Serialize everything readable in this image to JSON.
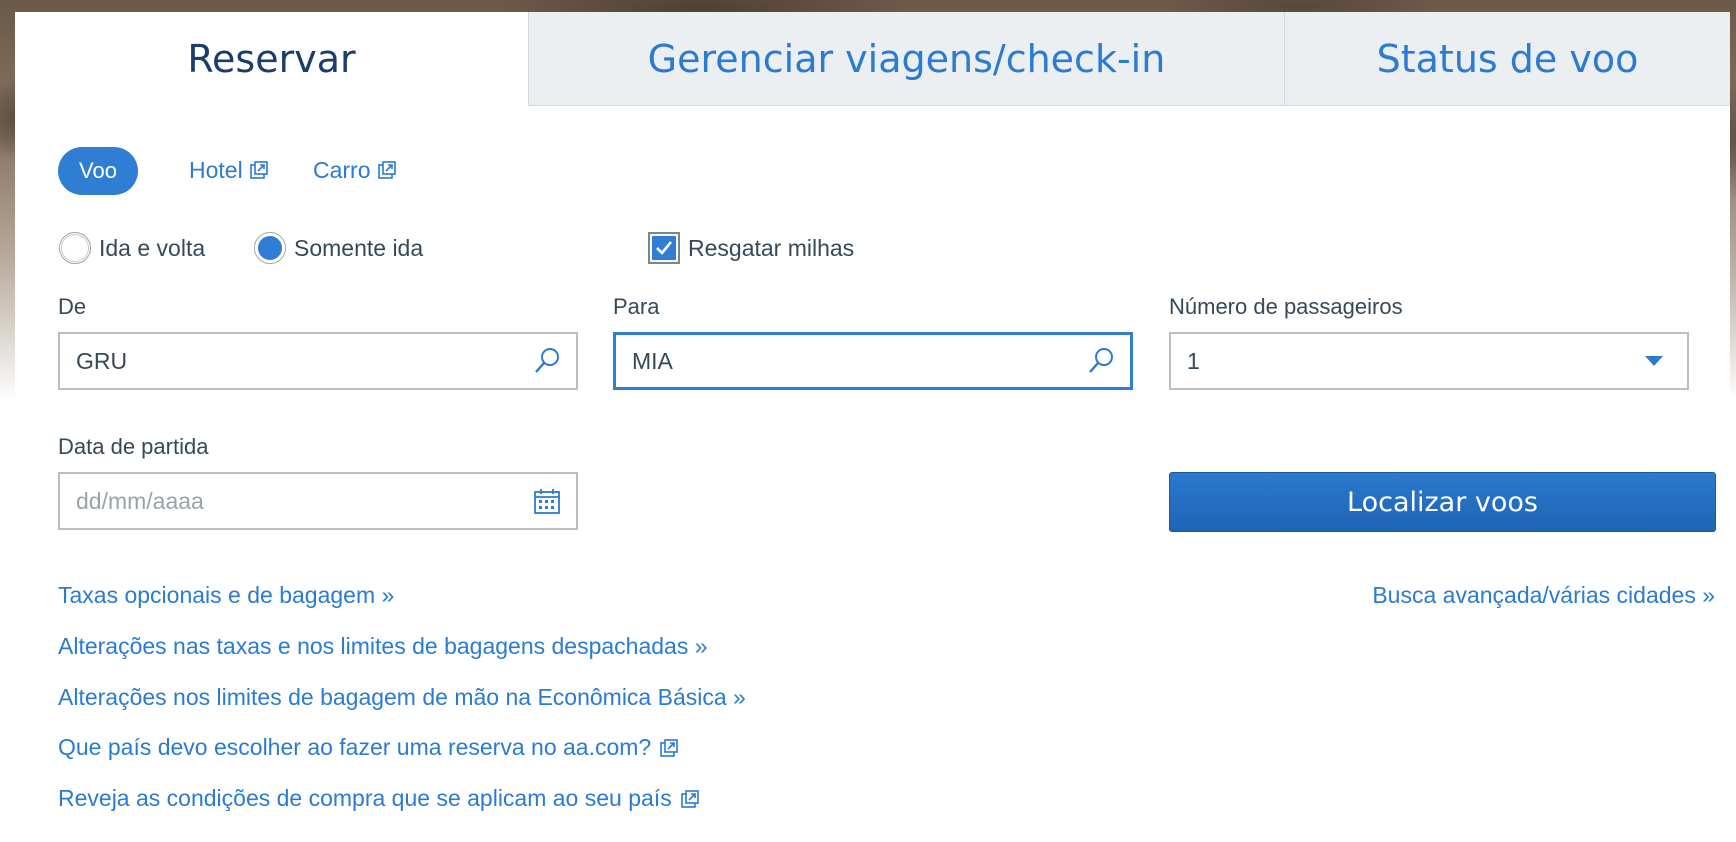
{
  "tabs": [
    {
      "label": "Reservar"
    },
    {
      "label": "Gerenciar viagens/check-in"
    },
    {
      "label": "Status de voo"
    }
  ],
  "products": {
    "flight": "Voo",
    "hotel": "Hotel",
    "car": "Carro"
  },
  "trip_type": {
    "round_trip": "Ida e volta",
    "one_way": "Somente ida",
    "selected": "one_way"
  },
  "redeem_miles": {
    "label": "Resgatar milhas",
    "checked": true
  },
  "from": {
    "label": "De",
    "value": "GRU"
  },
  "to": {
    "label": "Para",
    "value": "MIA"
  },
  "passengers": {
    "label": "Número de passageiros",
    "value": "1"
  },
  "departure": {
    "label": "Data de partida",
    "placeholder": "dd/mm/aaaa"
  },
  "search_button": "Localizar voos",
  "links": {
    "optional_fees": "Taxas opcionais e de bagagem »",
    "advanced_search": "Busca avançada/várias cidades »",
    "checked_bag_changes": "Alterações nas taxas e nos limites de bagagens despachadas »",
    "carryon_changes": "Alterações nos limites de bagagem de mão na Econômica Básica »",
    "which_country": "Que país devo escolher ao fazer uma reserva no aa.com?",
    "purchase_conditions": "Reveja as condições de compra que se aplicam ao seu país"
  },
  "colors": {
    "accent": "#2f7ed4",
    "link": "#2a7bd1",
    "active_tab_text": "#1a3d6e"
  }
}
